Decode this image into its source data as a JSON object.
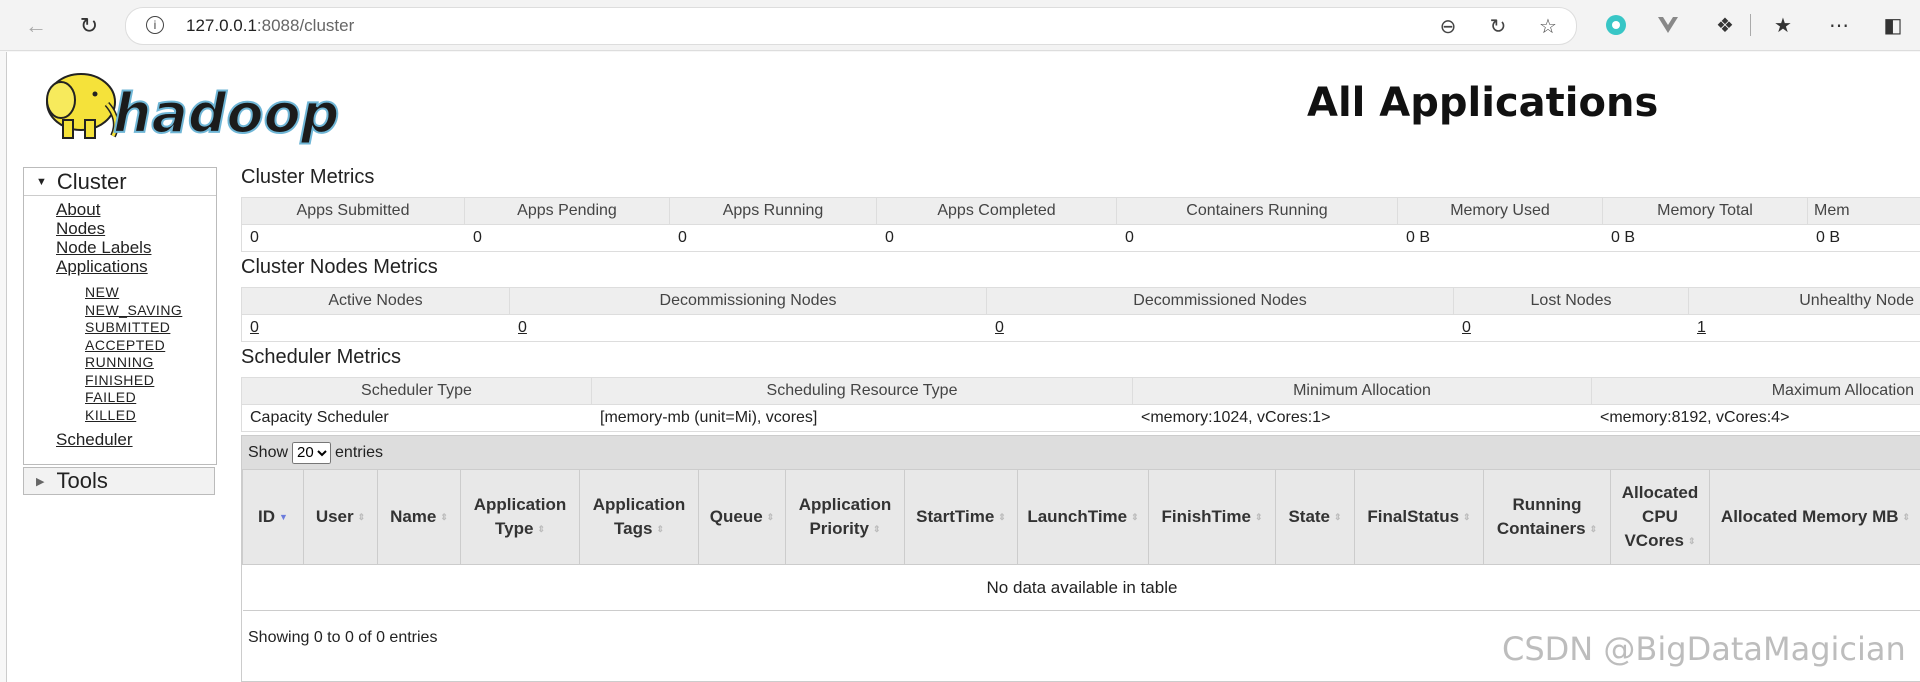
{
  "browser": {
    "url_host": "127.0.0.1",
    "url_rest": ":8088/cluster"
  },
  "page": {
    "title": "All Applications",
    "logo_text": "hadoop"
  },
  "nav": {
    "cluster_label": "Cluster",
    "links": [
      "About",
      "Nodes",
      "Node Labels",
      "Applications"
    ],
    "app_states": [
      "NEW",
      "NEW_SAVING",
      "SUBMITTED",
      "ACCEPTED",
      "RUNNING",
      "FINISHED",
      "FAILED",
      "KILLED"
    ],
    "scheduler": "Scheduler",
    "tools_label": "Tools"
  },
  "cluster_metrics": {
    "title": "Cluster Metrics",
    "headers": [
      "Apps Submitted",
      "Apps Pending",
      "Apps Running",
      "Apps Completed",
      "Containers Running",
      "Memory Used",
      "Memory Total",
      "Mem"
    ],
    "values": [
      "0",
      "0",
      "0",
      "0",
      "0",
      "0 B",
      "0 B",
      "0 B"
    ]
  },
  "node_metrics": {
    "title": "Cluster Nodes Metrics",
    "headers": [
      "Active Nodes",
      "Decommissioning Nodes",
      "Decommissioned Nodes",
      "Lost Nodes",
      "Unhealthy Node"
    ],
    "values": [
      "0",
      "0",
      "0",
      "0",
      "1"
    ]
  },
  "scheduler_metrics": {
    "title": "Scheduler Metrics",
    "headers": [
      "Scheduler Type",
      "Scheduling Resource Type",
      "Minimum Allocation",
      "Maximum Allocation"
    ],
    "values": [
      "Capacity Scheduler",
      "[memory-mb (unit=Mi), vcores]",
      "<memory:1024, vCores:1>",
      "<memory:8192, vCores:4>"
    ]
  },
  "apps_table": {
    "show_label": "Show",
    "entries_label": "entries",
    "page_size": "20",
    "columns": [
      "ID",
      "User",
      "Name",
      "Application Type",
      "Application Tags",
      "Queue",
      "Application Priority",
      "StartTime",
      "LaunchTime",
      "FinishTime",
      "State",
      "FinalStatus",
      "Running Containers",
      "Allocated CPU VCores",
      "Allocated Memory MB"
    ],
    "empty_message": "No data available in table",
    "info": "Showing 0 to 0 of 0 entries"
  },
  "watermark": "CSDN @BigDataMagician"
}
